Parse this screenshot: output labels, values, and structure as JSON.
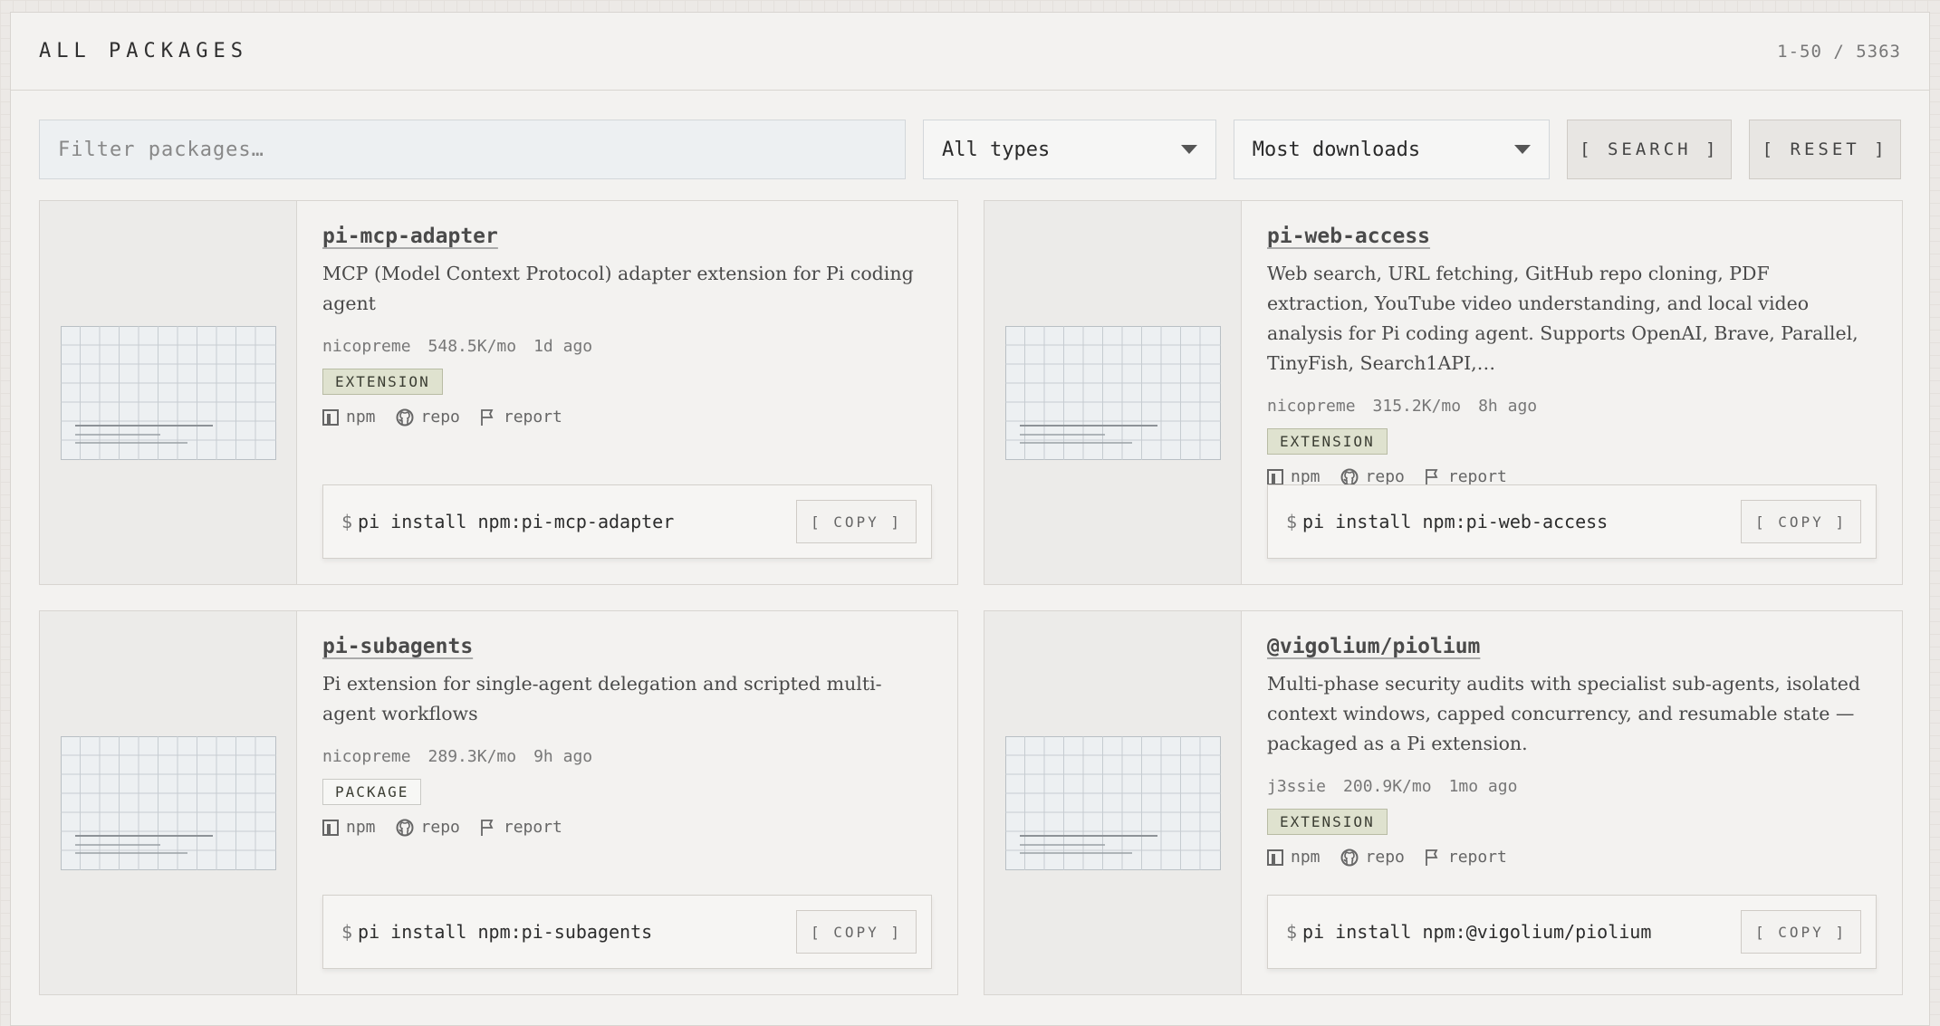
{
  "header": {
    "title": "ALL PACKAGES",
    "count": "1-50 / 5363"
  },
  "toolbar": {
    "filter_placeholder": "Filter packages…",
    "type_select": "All types",
    "sort_select": "Most downloads",
    "search_label": "[ SEARCH ]",
    "reset_label": "[ RESET ]"
  },
  "packages": [
    {
      "name": "pi-mcp-adapter",
      "description": "MCP (Model Context Protocol) adapter extension for Pi coding agent",
      "author": "nicopreme",
      "downloads": "548.5K/mo",
      "updated": "1d ago",
      "type": "EXTENSION",
      "npm": "npm",
      "repo": "repo",
      "report": "report",
      "dollar": "$",
      "install": "pi install npm:pi-mcp-adapter",
      "copy": "[ COPY ]"
    },
    {
      "name": "pi-web-access",
      "description": "Web search, URL fetching, GitHub repo cloning, PDF extraction, YouTube video understanding, and local video analysis for Pi coding agent. Supports OpenAI, Brave, Parallel, TinyFish, Search1API,…",
      "author": "nicopreme",
      "downloads": "315.2K/mo",
      "updated": "8h ago",
      "type": "EXTENSION",
      "npm": "npm",
      "repo": "repo",
      "report": "report",
      "dollar": "$",
      "install": "pi install npm:pi-web-access",
      "copy": "[ COPY ]"
    },
    {
      "name": "pi-subagents",
      "description": "Pi extension for single-agent delegation and scripted multi-agent workflows",
      "author": "nicopreme",
      "downloads": "289.3K/mo",
      "updated": "9h ago",
      "type": "PACKAGE",
      "npm": "npm",
      "repo": "repo",
      "report": "report",
      "dollar": "$",
      "install": "pi install npm:pi-subagents",
      "copy": "[ COPY ]"
    },
    {
      "name": "@vigolium/piolium",
      "description": "Multi-phase security audits with specialist sub-agents, isolated context windows, capped concurrency, and resumable state — packaged as a Pi extension.",
      "author": "j3ssie",
      "downloads": "200.9K/mo",
      "updated": "1mo ago",
      "type": "EXTENSION",
      "npm": "npm",
      "repo": "repo",
      "report": "report",
      "dollar": "$",
      "install": "pi install npm:@vigolium/piolium",
      "copy": "[ COPY ]"
    }
  ]
}
